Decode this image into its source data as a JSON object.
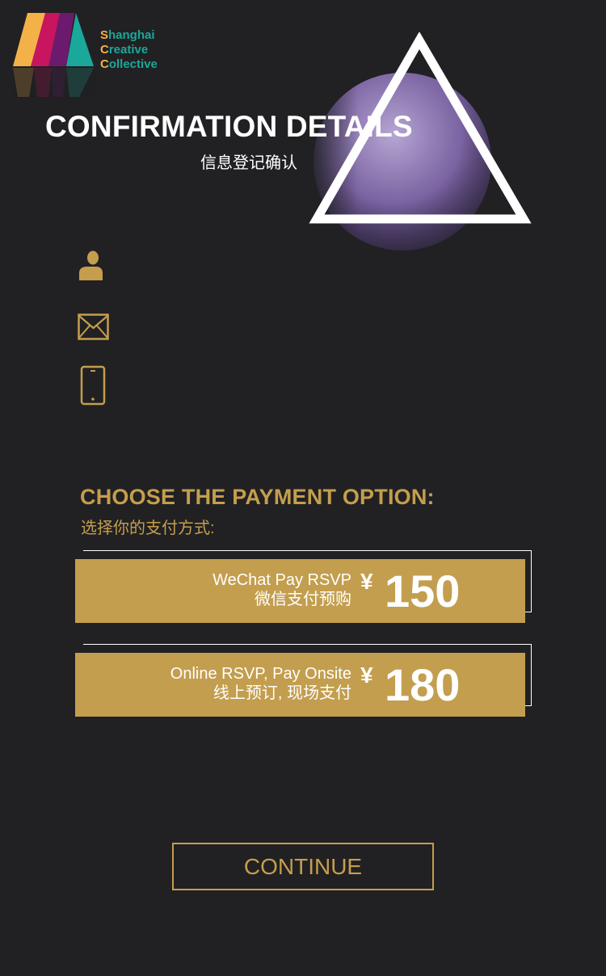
{
  "brand": {
    "line1_first": "S",
    "line1_rest": "hanghai",
    "line2_first": "C",
    "line2_rest": "reative",
    "line3_first": "C",
    "line3_rest": "ollective",
    "colors": {
      "orange": "#f3b247",
      "magenta": "#c7155f",
      "purple": "#6c1a6e",
      "teal": "#1aa89a"
    }
  },
  "header": {
    "title": "CONFIRMATION DETAILS",
    "subtitle": "信息登记确认"
  },
  "form": {
    "fields": [
      {
        "icon": "user-icon"
      },
      {
        "icon": "mail-icon"
      },
      {
        "icon": "phone-icon"
      }
    ]
  },
  "payment": {
    "heading": "CHOOSE THE PAYMENT OPTION:",
    "subheading": "选择你的支付方式:",
    "options": [
      {
        "label_en": "WeChat Pay RSVP",
        "label_cn": "微信支付预购",
        "currency": "¥",
        "price": "150"
      },
      {
        "label_en": "Online RSVP, Pay Onsite",
        "label_cn": "线上预订, 现场支付",
        "currency": "¥",
        "price": "180"
      }
    ]
  },
  "actions": {
    "continue_label": "CONTINUE"
  },
  "colors": {
    "background": "#212123",
    "gold": "#c59e4d",
    "card": "#c39e4e",
    "text": "#ffffff"
  }
}
